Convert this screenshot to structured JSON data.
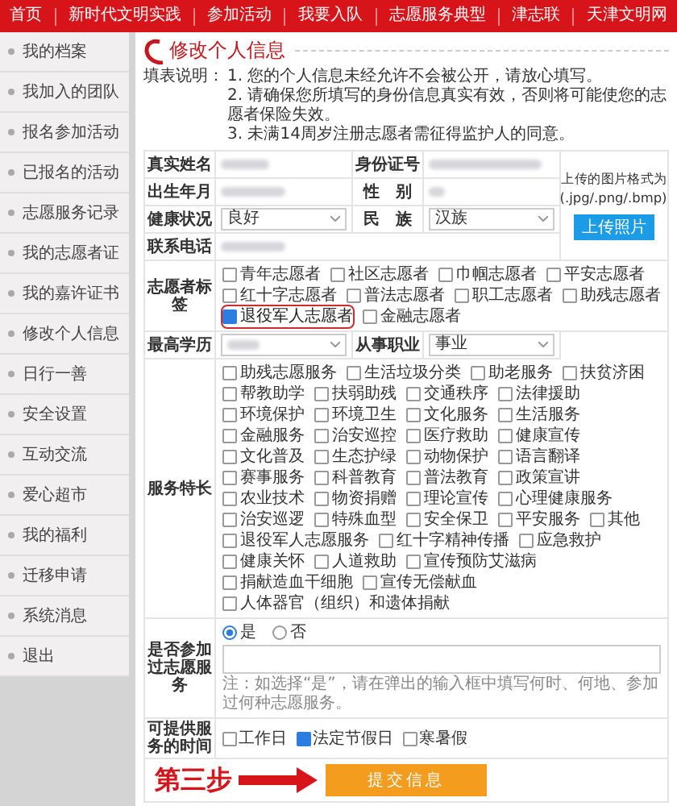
{
  "nav": [
    "首页",
    "新时代文明实践",
    "参加活动",
    "我要入队",
    "志愿服务典型",
    "津志联",
    "天津文明网"
  ],
  "sidebar": {
    "items": [
      "我的档案",
      "我加入的团队",
      "报名参加活动",
      "已报名的活动",
      "志愿服务记录",
      "我的志愿者证",
      "我的嘉许证书",
      "修改个人信息",
      "日行一善",
      "安全设置",
      "互动交流",
      "爱心超市",
      "我的福利",
      "迁移申请",
      "系统消息",
      "退出"
    ]
  },
  "page_title": "修改个人信息",
  "notes": {
    "label": "填表说明：",
    "items": [
      "1. 您的个人信息未经允许不会被公开，请放心填写。",
      "2. 请确保您所填写的身份信息真实有效，否则将可能使您的志愿者保险失效。",
      "3. 未满14周岁注册志愿者需征得监护人的同意。"
    ]
  },
  "form": {
    "name": {
      "label": "真实姓名"
    },
    "id_number": {
      "label": "身份证号"
    },
    "birth": {
      "label": "出生年月"
    },
    "gender": {
      "label": "性　别"
    },
    "health": {
      "label": "健康状况",
      "value": "良好"
    },
    "ethnicity": {
      "label": "民　族",
      "value": "汉族"
    },
    "phone": {
      "label": "联系电话"
    },
    "photo": {
      "hint": "上传的图片格式为",
      "formats": "(.jpg/.png/.bmp)",
      "button": "上传照片"
    },
    "tags": {
      "label": "志愿者标签",
      "options": [
        {
          "label": "青年志愿者",
          "checked": false,
          "highlighted": false
        },
        {
          "label": "社区志愿者",
          "checked": false,
          "highlighted": false
        },
        {
          "label": "巾帼志愿者",
          "checked": false,
          "highlighted": false
        },
        {
          "label": "平安志愿者",
          "checked": false,
          "highlighted": false
        },
        {
          "label": "红十字志愿者",
          "checked": false,
          "highlighted": false
        },
        {
          "label": "普法志愿者",
          "checked": false,
          "highlighted": false
        },
        {
          "label": "职工志愿者",
          "checked": false,
          "highlighted": false
        },
        {
          "label": "助残志愿者",
          "checked": false,
          "highlighted": false
        },
        {
          "label": "退役军人志愿者",
          "checked": true,
          "highlighted": true
        },
        {
          "label": "金融志愿者",
          "checked": false,
          "highlighted": false
        }
      ]
    },
    "education": {
      "label": "最高学历"
    },
    "occupation": {
      "label": "从事职业",
      "value": "事业"
    },
    "specialties": {
      "label": "服务特长",
      "options": [
        {
          "label": "助残志愿服务",
          "checked": false
        },
        {
          "label": "生活垃圾分类",
          "checked": false
        },
        {
          "label": "助老服务",
          "checked": false
        },
        {
          "label": "扶贫济困",
          "checked": false
        },
        {
          "label": "帮教助学",
          "checked": false
        },
        {
          "label": "扶弱助残",
          "checked": false
        },
        {
          "label": "交通秩序",
          "checked": false
        },
        {
          "label": "法律援助",
          "checked": false
        },
        {
          "label": "环境保护",
          "checked": false
        },
        {
          "label": "环境卫生",
          "checked": false
        },
        {
          "label": "文化服务",
          "checked": false
        },
        {
          "label": "生活服务",
          "checked": false
        },
        {
          "label": "金融服务",
          "checked": false
        },
        {
          "label": "治安巡控",
          "checked": false
        },
        {
          "label": "医疗救助",
          "checked": false
        },
        {
          "label": "健康宣传",
          "checked": false
        },
        {
          "label": "文化普及",
          "checked": false
        },
        {
          "label": "生态护绿",
          "checked": false
        },
        {
          "label": "动物保护",
          "checked": false
        },
        {
          "label": "语言翻译",
          "checked": false
        },
        {
          "label": "赛事服务",
          "checked": false
        },
        {
          "label": "科普教育",
          "checked": false
        },
        {
          "label": "普法教育",
          "checked": false
        },
        {
          "label": "政策宣讲",
          "checked": false
        },
        {
          "label": "农业技术",
          "checked": false
        },
        {
          "label": "物资捐赠",
          "checked": false
        },
        {
          "label": "理论宣传",
          "checked": false
        },
        {
          "label": "心理健康服务",
          "checked": false
        },
        {
          "label": "治安巡逻",
          "checked": false
        },
        {
          "label": "特殊血型",
          "checked": false
        },
        {
          "label": "安全保卫",
          "checked": false
        },
        {
          "label": "平安服务",
          "checked": false
        },
        {
          "label": "其他",
          "checked": false
        },
        {
          "label": "退役军人志愿服务",
          "checked": false
        },
        {
          "label": "红十字精神传播",
          "checked": false
        },
        {
          "label": "应急救护",
          "checked": false
        },
        {
          "label": "健康关怀",
          "checked": false
        },
        {
          "label": "人道救助",
          "checked": false
        },
        {
          "label": "宣传预防艾滋病",
          "checked": false
        },
        {
          "label": "捐献造血干细胞",
          "checked": false
        },
        {
          "label": "宣传无偿献血",
          "checked": false
        },
        {
          "label": "人体器官（组织）和遗体捐献",
          "checked": false
        }
      ]
    },
    "past_service": {
      "label": "是否参加过志愿服务",
      "options": [
        {
          "label": "是",
          "selected": true
        },
        {
          "label": "否",
          "selected": false
        }
      ],
      "note": "注：如选择“是”，请在弹出的输入框中填写何时、何地、参加过何种志愿服务。"
    },
    "availability": {
      "label": "可提供服务的时间",
      "options": [
        {
          "label": "工作日",
          "checked": false
        },
        {
          "label": "法定节假日",
          "checked": true
        },
        {
          "label": "寒暑假",
          "checked": false
        }
      ]
    },
    "submit": "提交信息"
  },
  "annotation": {
    "text": "第三步"
  }
}
